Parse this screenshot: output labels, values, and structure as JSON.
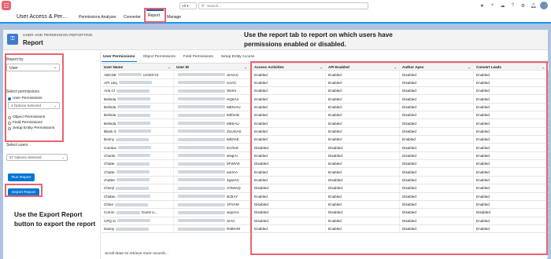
{
  "header": {
    "scope": "All",
    "search_placeholder": "Search...",
    "icons": [
      "favorites-icon",
      "add-icon",
      "trailhead-icon",
      "help-icon",
      "setup-gear-icon",
      "notifications-bell-icon"
    ]
  },
  "nav": {
    "app_name": "User Access & Per...",
    "items": [
      "Permissions Analyzer",
      "Converter",
      "Report",
      "Manage"
    ]
  },
  "page": {
    "eyebrow": "USER AND PERMISSION REPORTING",
    "title": "Report",
    "callout_top": "Use the report tab to report on which users have permissions enabled or disabled."
  },
  "sidebar": {
    "report_by_label": "Report by",
    "report_by_value": "User",
    "select_permissions_label": "Select permissions",
    "perm_options": [
      "User Permissions",
      "Object Permissions",
      "Field Permissions",
      "Setup Entity Permissions"
    ],
    "options_selected": "4 Options Selected",
    "select_users_label": "Select users",
    "users_selected": "67 Options Selected",
    "run_report": "Run Report",
    "export_report": "Export Report",
    "callout_left": "Use the Export Report button to export the report"
  },
  "tabs": [
    "User Permissions",
    "Object Permissions",
    "Field Permissions",
    "Setup Entity Access"
  ],
  "table": {
    "headers": [
      "User Name",
      "User ID",
      "Access Activities",
      "API Enabled",
      "Author Apex",
      "Convert Leads"
    ],
    "rows": [
      {
        "name": "ABCDE",
        "name_tail": "UVWXYZ",
        "id": "SIAIAC",
        "v": [
          "Enabled",
          "Enabled",
          "Disabled",
          "Enabled"
        ]
      },
      {
        "name": "API Usq",
        "name_tail": "",
        "id": "ecIAC",
        "v": [
          "Enabled",
          "Enabled",
          "Disabled",
          "Enabled"
        ]
      },
      {
        "name": "Aria Cl",
        "name_tail": "",
        "id": "SkIIAI",
        "v": [
          "Enabled",
          "Enabled",
          "Disabled",
          "Enabled"
        ]
      },
      {
        "name": "Belinda",
        "name_tail": "",
        "id": "HQIIA4",
        "v": [
          "Enabled",
          "Enabled",
          "Disabled",
          "Enabled"
        ]
      },
      {
        "name": "Belinda",
        "name_tail": "",
        "id": "MEKIAU",
        "v": [
          "Enabled",
          "Enabled",
          "Disabled",
          "Enabled"
        ]
      },
      {
        "name": "Belinda",
        "name_tail": "",
        "id": "IMIhIAE",
        "v": [
          "Enabled",
          "Enabled",
          "Disabled",
          "Enabled"
        ]
      },
      {
        "name": "Belinda",
        "name_tail": "",
        "id": "MEIIAU",
        "v": [
          "Enabled",
          "Enabled",
          "Disabled",
          "Enabled"
        ]
      },
      {
        "name": "Blank S",
        "name_tail": "",
        "id": "ZoUnIAK",
        "v": [
          "Enabled",
          "Enabled",
          "Disabled",
          "Enabled"
        ]
      },
      {
        "name": "Bonny",
        "name_tail": "",
        "id": "8dDIAE",
        "v": [
          "Enabled",
          "Enabled",
          "Enabled",
          "Enabled"
        ]
      },
      {
        "name": "Carolus",
        "name_tail": "",
        "id": "ECfIAE",
        "v": [
          "Disabled",
          "Disabled",
          "Disabled",
          "Enabled"
        ]
      },
      {
        "name": "Charlie",
        "name_tail": "",
        "id": "sNqIAI",
        "v": [
          "Enabled",
          "Disabled",
          "Disabled",
          "Enabled"
        ]
      },
      {
        "name": "Chatte",
        "name_tail": "",
        "id": "bFWIA0",
        "v": [
          "Disabled",
          "Enabled",
          "Disabled",
          "Enabled"
        ]
      },
      {
        "name": "Chatte",
        "name_tail": "",
        "id": "earIAA",
        "v": [
          "Enabled",
          "Enabled",
          "Disabled",
          "Enabled"
        ]
      },
      {
        "name": "chatter",
        "name_tail": "",
        "id": "4gwIAC",
        "v": [
          "Enabled",
          "Disabled",
          "Disabled",
          "Enabled"
        ]
      },
      {
        "name": "Cheryl",
        "name_tail": "",
        "id": "cOMIAQ",
        "v": [
          "Disabled",
          "Disabled",
          "Disabled",
          "Enabled"
        ]
      },
      {
        "name": "Chidan",
        "name_tail": "",
        "id": "IEZIAY",
        "v": [
          "Enabled",
          "Enabled",
          "Disabled",
          "Enabled"
        ]
      },
      {
        "name": "Chloe",
        "name_tail": "",
        "id": "1PSAM",
        "v": [
          "Disabled",
          "Enabled",
          "Disabled",
          "Enabled"
        ]
      },
      {
        "name": "Comm",
        "name_tail": "Guest U...",
        "id": "wqoIAA",
        "v": [
          "Disabled",
          "Disabled",
          "Disabled",
          "Disabled"
        ]
      },
      {
        "name": "CPQ In",
        "name_tail": "",
        "id": "SIAC",
        "v": [
          "Disabled",
          "Enabled",
          "Disabled",
          "Enabled"
        ]
      },
      {
        "name": "Danny",
        "name_tail": "",
        "id": "RsBIAW",
        "v": [
          "Enabled",
          "Enabled",
          "Disabled",
          "Enabled"
        ]
      }
    ],
    "scroll_note": "Scroll down to retrieve more records..."
  },
  "colors": {
    "accent": "#0176d3",
    "highlight": "#e9636f",
    "background": "#b0c4df"
  }
}
